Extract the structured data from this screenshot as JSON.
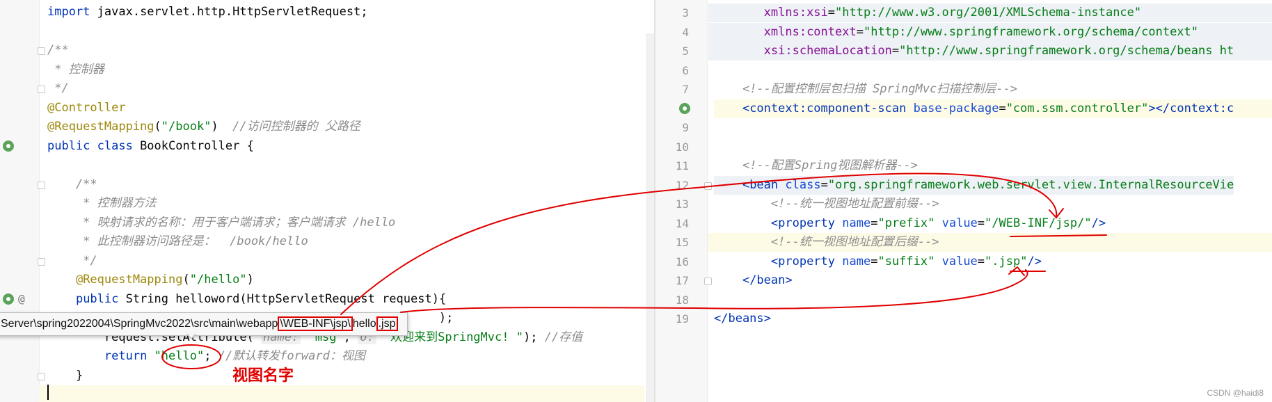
{
  "left_editor": {
    "lines": [
      {
        "id": "l1",
        "segments": [
          {
            "cls": "kw",
            "t": "import"
          },
          {
            "t": " javax.servlet.http.HttpServletRequest;"
          }
        ]
      },
      {
        "id": "l2",
        "segments": []
      },
      {
        "id": "l3",
        "segments": [
          {
            "cls": "cmt",
            "t": "/**"
          }
        ]
      },
      {
        "id": "l4",
        "segments": [
          {
            "cls": "cmt",
            "t": " * 控制器"
          }
        ]
      },
      {
        "id": "l5",
        "segments": [
          {
            "cls": "cmt",
            "t": " */"
          }
        ]
      },
      {
        "id": "l6",
        "segments": [
          {
            "cls": "ann",
            "t": "@Controller"
          }
        ]
      },
      {
        "id": "l7",
        "segments": [
          {
            "cls": "ann",
            "t": "@RequestMapping"
          },
          {
            "t": "("
          },
          {
            "cls": "str",
            "t": "\"/book\""
          },
          {
            "t": ")  "
          },
          {
            "cls": "cmt",
            "t": "//访问控制器的 父路径"
          }
        ]
      },
      {
        "id": "l8",
        "segments": [
          {
            "cls": "kw",
            "t": "public class"
          },
          {
            "t": " BookController {"
          }
        ]
      },
      {
        "id": "l9",
        "segments": []
      },
      {
        "id": "l10",
        "segments": [
          {
            "cls": "cmt",
            "t": "    /**"
          }
        ]
      },
      {
        "id": "l11",
        "segments": [
          {
            "cls": "cmt",
            "t": "     * 控制器方法"
          }
        ]
      },
      {
        "id": "l12",
        "segments": [
          {
            "cls": "cmt",
            "t": "     * 映射请求的名称：用于客户端请求；客户端请求 /hello"
          }
        ]
      },
      {
        "id": "l13",
        "segments": [
          {
            "cls": "cmt",
            "t": "     * 此控制器访问路径是：  /book/hello"
          }
        ]
      },
      {
        "id": "l14",
        "segments": [
          {
            "cls": "cmt",
            "t": "     */"
          }
        ]
      },
      {
        "id": "l15",
        "segments": [
          {
            "t": "    "
          },
          {
            "cls": "ann",
            "t": "@RequestMapping"
          },
          {
            "t": "("
          },
          {
            "cls": "str",
            "t": "\"/hello\""
          },
          {
            "t": ")"
          }
        ]
      },
      {
        "id": "l16",
        "segments": [
          {
            "t": "    "
          },
          {
            "cls": "kw",
            "t": "public"
          },
          {
            "t": " String helloword(HttpServletRequest request){"
          }
        ]
      },
      {
        "id": "l17",
        "segments": [
          {
            "t": "                                                       );"
          }
        ]
      },
      {
        "id": "l18",
        "segments": [
          {
            "t": "        request.setAttribute( "
          },
          {
            "cls": "hint",
            "t": "name:"
          },
          {
            "t": " "
          },
          {
            "cls": "str",
            "t": "\"msg\""
          },
          {
            "t": ", "
          },
          {
            "cls": "hint",
            "t": "o:"
          },
          {
            "t": " "
          },
          {
            "cls": "str",
            "t": "\"欢迎来到SpringMvc! \""
          },
          {
            "t": "); "
          },
          {
            "cls": "cmt",
            "t": "//存值"
          }
        ]
      },
      {
        "id": "l19",
        "segments": [
          {
            "t": "        "
          },
          {
            "cls": "kw",
            "t": "return"
          },
          {
            "t": " "
          },
          {
            "cls": "str",
            "t": "\"hello\""
          },
          {
            "t": "; "
          },
          {
            "cls": "cmt",
            "t": "//默认转发forward：视图"
          }
        ]
      },
      {
        "id": "l20",
        "segments": [
          {
            "t": "    }"
          }
        ]
      },
      {
        "id": "l21",
        "segments": []
      }
    ]
  },
  "right_editor": {
    "lines": [
      {
        "n": "3",
        "segments": [
          {
            "t": "       "
          },
          {
            "cls": "ns",
            "t": "xmlns:xsi"
          },
          {
            "t": "="
          },
          {
            "cls": "str",
            "t": "\"http://www.w3.org/2001/XMLSchema-instance\""
          }
        ]
      },
      {
        "n": "4",
        "segments": [
          {
            "t": "       "
          },
          {
            "cls": "ns",
            "t": "xmlns:context"
          },
          {
            "t": "="
          },
          {
            "cls": "str",
            "t": "\"http://www.springframework.org/schema/context\""
          }
        ]
      },
      {
        "n": "5",
        "segments": [
          {
            "t": "       "
          },
          {
            "cls": "ns",
            "t": "xsi:schemaLocation"
          },
          {
            "t": "="
          },
          {
            "cls": "str",
            "t": "\"http://www.springframework.org/schema/beans ht"
          }
        ]
      },
      {
        "n": "6",
        "segments": []
      },
      {
        "n": "7",
        "segments": [
          {
            "t": "    "
          },
          {
            "cls": "cmt",
            "t": "<!--配置控制层包扫描 SpringMvc扫描控制层-->"
          }
        ]
      },
      {
        "n": "8",
        "segments": [
          {
            "t": "    "
          },
          {
            "cls": "tag",
            "t": "<context:component-scan"
          },
          {
            "t": " "
          },
          {
            "cls": "attr",
            "t": "base-package"
          },
          {
            "t": "="
          },
          {
            "cls": "str",
            "t": "\"com.ssm.controller\""
          },
          {
            "cls": "tag",
            "t": "></context:c"
          }
        ]
      },
      {
        "n": "9",
        "segments": []
      },
      {
        "n": "10",
        "segments": []
      },
      {
        "n": "11",
        "segments": [
          {
            "t": "    "
          },
          {
            "cls": "cmt",
            "t": "<!--配置Spring视图解析器-->"
          }
        ]
      },
      {
        "n": "12",
        "segments": [
          {
            "t": "    "
          },
          {
            "cls": "tag",
            "t": "<bean"
          },
          {
            "t": " "
          },
          {
            "cls": "attr",
            "t": "class"
          },
          {
            "t": "="
          },
          {
            "cls": "str",
            "t": "\"org.springframework.web.servlet.view.InternalResourceVie"
          }
        ]
      },
      {
        "n": "13",
        "segments": [
          {
            "t": "        "
          },
          {
            "cls": "cmt",
            "t": "<!--统一视图地址配置前缀-->"
          }
        ]
      },
      {
        "n": "14",
        "segments": [
          {
            "t": "        "
          },
          {
            "cls": "tag",
            "t": "<property"
          },
          {
            "t": " "
          },
          {
            "cls": "attr",
            "t": "name"
          },
          {
            "t": "="
          },
          {
            "cls": "str",
            "t": "\"prefix\""
          },
          {
            "t": " "
          },
          {
            "cls": "attr",
            "t": "value"
          },
          {
            "t": "="
          },
          {
            "cls": "str",
            "t": "\"/WEB-INF/jsp/\""
          },
          {
            "cls": "tag",
            "t": "/>"
          }
        ]
      },
      {
        "n": "15",
        "segments": [
          {
            "t": "        "
          },
          {
            "cls": "cmt",
            "t": "<!--统一视图地址配置后缀-->"
          }
        ]
      },
      {
        "n": "16",
        "segments": [
          {
            "t": "        "
          },
          {
            "cls": "tag",
            "t": "<property"
          },
          {
            "t": " "
          },
          {
            "cls": "attr",
            "t": "name"
          },
          {
            "t": "="
          },
          {
            "cls": "str",
            "t": "\"suffix\""
          },
          {
            "t": " "
          },
          {
            "cls": "attr",
            "t": "value"
          },
          {
            "t": "="
          },
          {
            "cls": "str",
            "t": "\".jsp\""
          },
          {
            "cls": "tag",
            "t": "/>"
          }
        ]
      },
      {
        "n": "17",
        "segments": [
          {
            "t": "    "
          },
          {
            "cls": "tag",
            "t": "</bean>"
          }
        ]
      },
      {
        "n": "18",
        "segments": []
      },
      {
        "n": "19",
        "segments": [
          {
            "cls": "tag",
            "t": "</beans>"
          }
        ]
      }
    ]
  },
  "tooltip": {
    "path_start": "Server\\spring2022004\\SpringMvc2022\\src\\main\\webapp",
    "path_box1": "\\WEB-INF\\jsp\\",
    "path_mid": "hello",
    "path_box2": ".jsp"
  },
  "annotation": {
    "caption": "视图名字",
    "color": "#e00000"
  },
  "watermark": "CSDN @haidi8"
}
